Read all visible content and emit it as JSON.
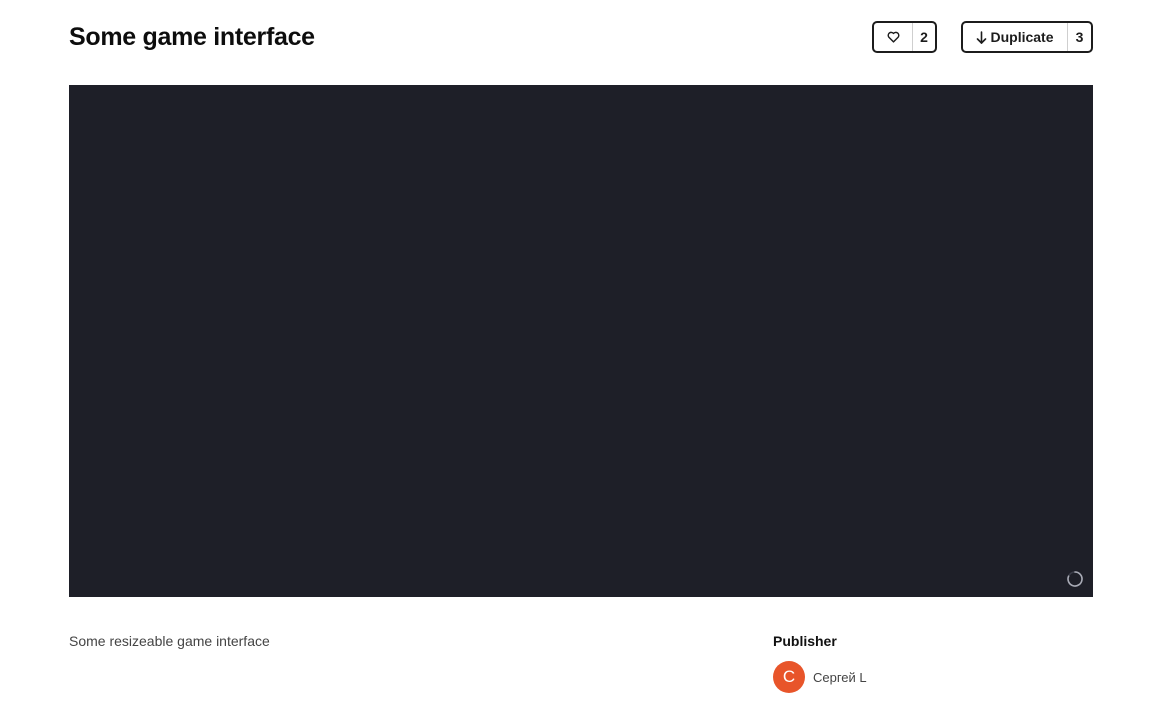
{
  "header": {
    "title": "Some game interface",
    "like": {
      "icon": "heart-icon",
      "count": "2"
    },
    "duplicate": {
      "icon": "arrow-down-icon",
      "label": "Duplicate",
      "count": "3"
    }
  },
  "player": {
    "background_color": "#1e1f28",
    "status_icon": "loading-spinner-icon"
  },
  "description": "Some resizeable game interface",
  "publisher": {
    "heading": "Publisher",
    "avatar_initial": "С",
    "avatar_color": "#e8552a",
    "name": "Сергей L"
  }
}
